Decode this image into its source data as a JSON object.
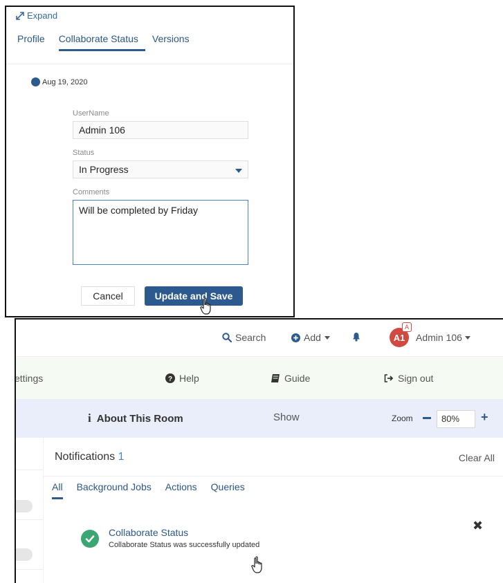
{
  "dialog": {
    "expand_label": "Expand",
    "tabs": [
      {
        "label": "Profile"
      },
      {
        "label": "Collaborate Status"
      },
      {
        "label": "Versions"
      }
    ],
    "timeline_date": "Aug 19, 2020",
    "username_label": "UserName",
    "username_value": "Admin 106",
    "status_label": "Status",
    "status_value": "In Progress",
    "comments_label": "Comments",
    "comments_value": "Will be completed by Friday",
    "cancel_label": "Cancel",
    "save_label": "Update and Save"
  },
  "header": {
    "search_label": "Search",
    "add_label": "Add",
    "avatar_initials": "A1",
    "avatar_badge": "A",
    "user_name": "Admin 106"
  },
  "links": {
    "settings_label": "ettings",
    "help_label": "Help",
    "guide_label": "Guide",
    "signout_label": "Sign out"
  },
  "room": {
    "about_label": "About This Room",
    "show_label": "Show",
    "zoom_label": "Zoom",
    "zoom_value": "80%"
  },
  "notifications": {
    "title": "Notifications",
    "count": "1",
    "clear_all": "Clear All",
    "tabs": [
      {
        "label": "All"
      },
      {
        "label": "Background Jobs"
      },
      {
        "label": "Actions"
      },
      {
        "label": "Queries"
      }
    ],
    "item_title": "Collaborate Status",
    "item_desc": "Collaborate Status was successfully updated"
  },
  "colors": {
    "accent": "#2d5a8e",
    "success": "#3aa672",
    "avatar": "#d24a3f"
  }
}
